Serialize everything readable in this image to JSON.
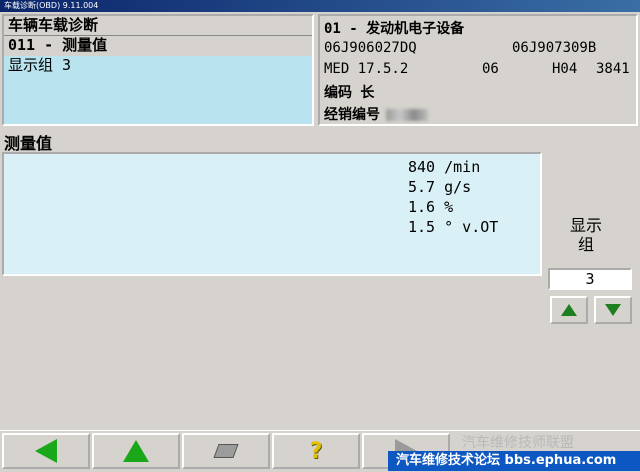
{
  "window": {
    "title": "车载诊断(OBD) 9.11.004"
  },
  "left_panel": {
    "line1": "车辆车载诊断",
    "line2": "011 - 测量值",
    "selected": "显示组 3"
  },
  "right_panel": {
    "line1": "01 - 发动机电子设备",
    "part_number_a": "06J906027DQ",
    "part_number_b": "06J907309B",
    "ecu_name": "MED 17.5.2",
    "ecu_code1": "06",
    "ecu_code2": "H04",
    "ecu_code3": "3841",
    "coding_label": "编码 长",
    "dealer_label": "经销编号"
  },
  "measurements": {
    "title": "测量值",
    "values": [
      "840 /min",
      "5.7 g/s",
      "1.6 %",
      "1.5 ° v.OT"
    ]
  },
  "display_group": {
    "label_line1": "显示",
    "label_line2": "组",
    "value": "3"
  },
  "toolbar": {
    "icons": [
      "back-arrow-icon",
      "up-arrow-icon",
      "printer-icon",
      "help-icon",
      "forward-arrow-icon"
    ]
  },
  "watermark": {
    "line1": "汽车维修技师联盟",
    "line2": "汽车维修技术论坛 bbs.ephua.com"
  },
  "colors": {
    "selection": "#b9e3ee",
    "values_bg": "#d9f1f6",
    "arrow_green": "#1aa81a",
    "watermark_blue": "#0c57c2"
  }
}
